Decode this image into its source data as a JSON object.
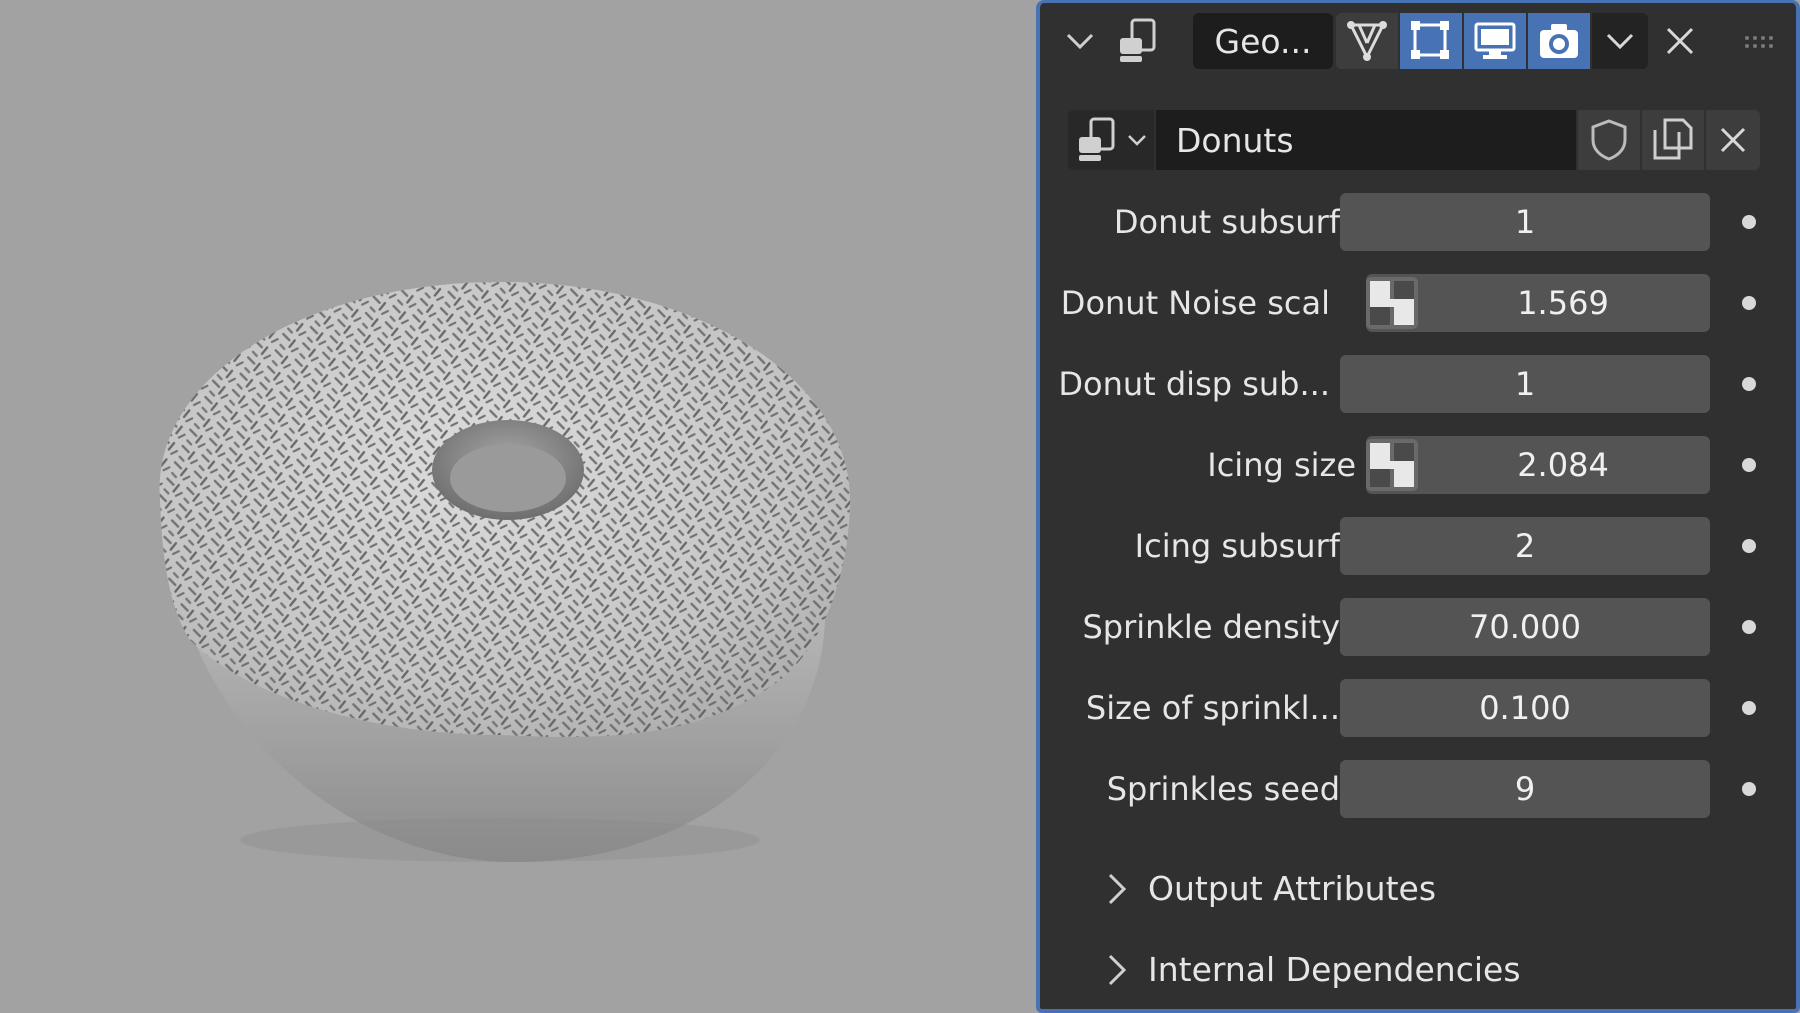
{
  "header": {
    "collapse_icon": "chevron-down-icon",
    "editor_type_icon": "properties-editor-icon",
    "modifier_name": "Geo...",
    "toolbar_icons": [
      "edit-mode-icon",
      "on-cage-icon",
      "viewport-display-icon",
      "render-camera-icon"
    ],
    "dropdown_icon": "chevron-down-icon",
    "close_icon": "close-icon",
    "drag_icon": "drag-handle-icon"
  },
  "datablock": {
    "name": "Donuts",
    "fake_user_icon": "shield-icon",
    "duplicate_icon": "duplicate-icon",
    "unlink_icon": "close-icon"
  },
  "properties": [
    {
      "label": "Donut subsurf",
      "value": "1",
      "texture": false
    },
    {
      "label": "Donut Noise scal",
      "value": "1.569",
      "texture": true
    },
    {
      "label": "Donut disp sub...",
      "value": "1",
      "texture": false
    },
    {
      "label": "Icing size",
      "value": "2.084",
      "texture": true
    },
    {
      "label": "Icing subsurf",
      "value": "2",
      "texture": false
    },
    {
      "label": "Sprinkle density",
      "value": "70.000",
      "texture": false
    },
    {
      "label": "Size of sprinkl...",
      "value": "0.100",
      "texture": false
    },
    {
      "label": "Sprinkles seed",
      "value": "9",
      "texture": false
    }
  ],
  "sections": [
    {
      "label": "Output Attributes"
    },
    {
      "label": "Internal Dependencies"
    }
  ],
  "colors": {
    "accent": "#4772b3",
    "panel_bg": "#303030",
    "field_bg": "#545454",
    "viewport_bg": "#a2a2a2"
  }
}
